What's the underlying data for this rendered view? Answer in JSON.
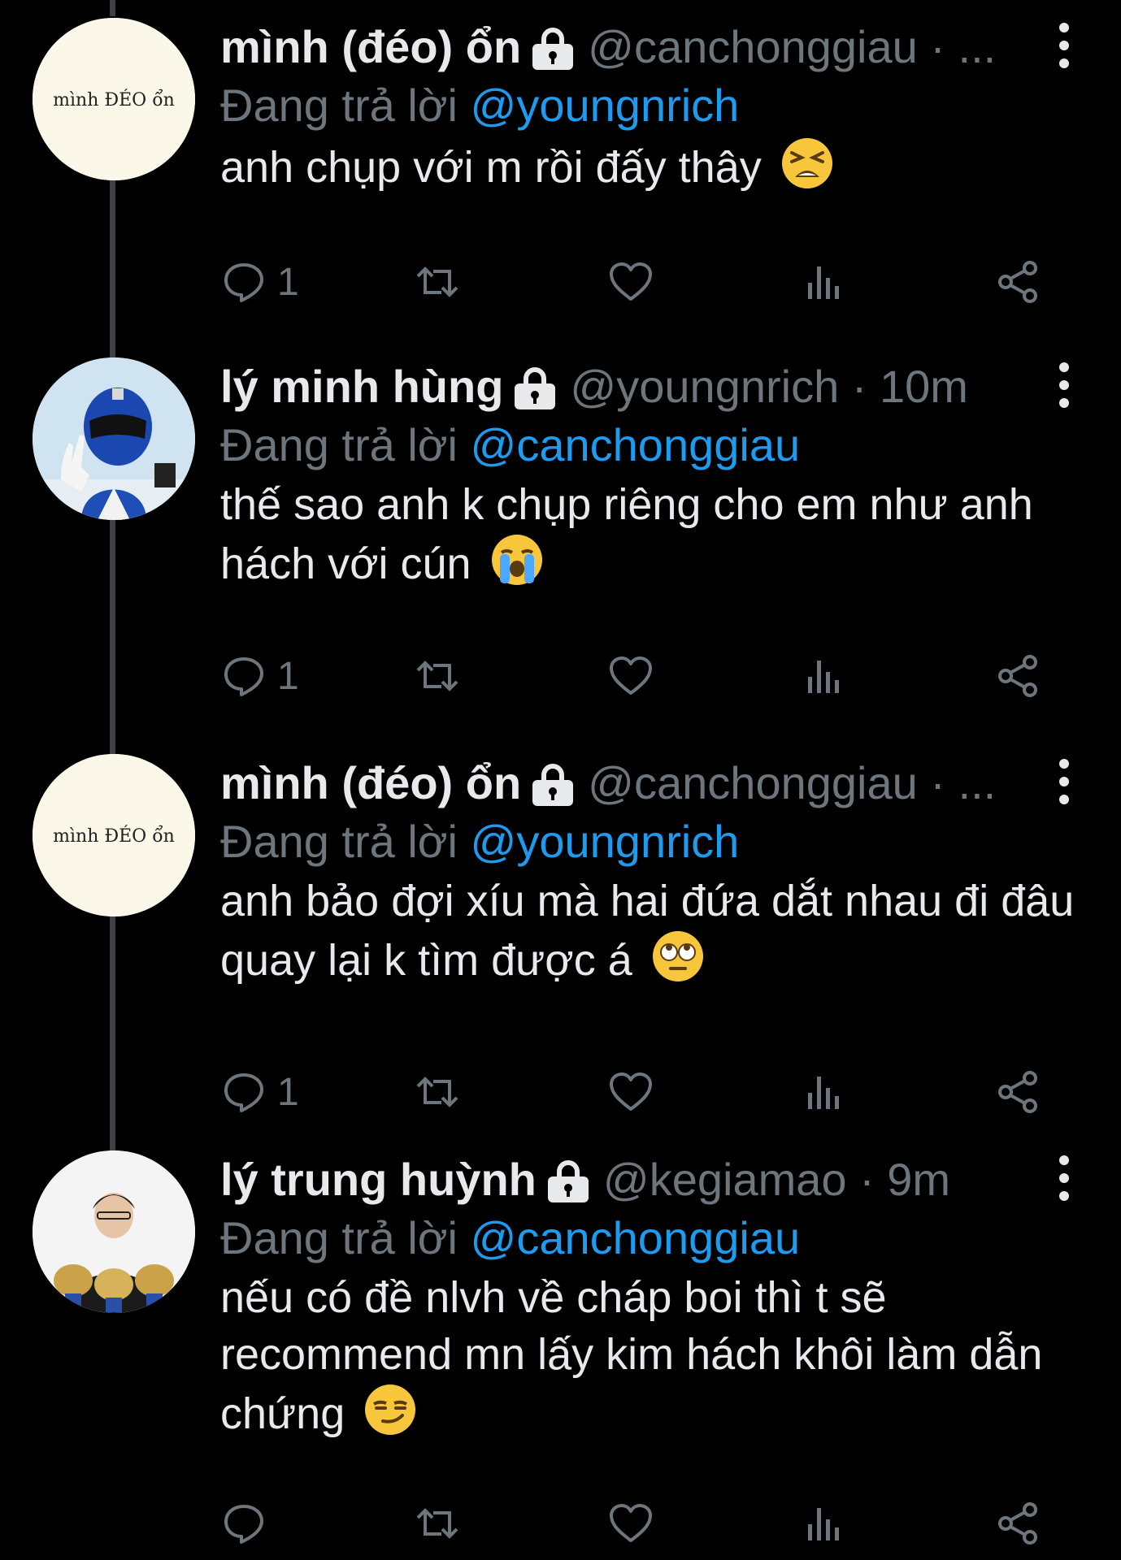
{
  "tweets": [
    {
      "display_name": "mình (đéo) ổn",
      "meta": "@canchonggiau · ...",
      "reply_prefix": "Đang trả lời",
      "reply_to": "@youngnrich",
      "text": "anh chụp với m rồi đấy thây",
      "emoji": "tired-face-emoji",
      "reply_count": "1",
      "avatar": "minh-deo-on-logo",
      "avatar_text": "mình ĐÉO ổn"
    },
    {
      "display_name": "lý minh hùng",
      "meta": "@youngnrich · 10m",
      "reply_prefix": "Đang trả lời",
      "reply_to": "@canchonggiau",
      "text": "thế sao anh k chụp riêng cho em như anh hách với cún",
      "emoji": "loudly-crying-face-emoji",
      "reply_count": "1",
      "avatar": "blue-ranger-photo"
    },
    {
      "display_name": "mình (đéo) ổn",
      "meta": "@canchonggiau · ...",
      "reply_prefix": "Đang trả lời",
      "reply_to": "@youngnrich",
      "text": "anh bảo đợi xíu mà hai đứa dắt nhau đi đâu quay lại k tìm được á",
      "emoji": "face-with-rolling-eyes-emoji",
      "reply_count": "1",
      "avatar": "minh-deo-on-logo",
      "avatar_text": "mình ĐÉO ổn"
    },
    {
      "display_name": "lý trung huỳnh",
      "meta": "@kegiamao · 9m",
      "reply_prefix": "Đang trả lời",
      "reply_to": "@canchonggiau",
      "text": "nếu có đề nlvh về cháp boi thì t sẽ recommend mn lấy kim hách khôi làm dẫn chứng",
      "emoji": "smirking-face-emoji",
      "reply_count": "",
      "avatar": "person-with-trophies-photo"
    }
  ],
  "colors": {
    "background": "#000000",
    "text": "#e7e9ea",
    "secondary": "#6e767d",
    "mention": "#1d9bf0",
    "thread_line": "#3d4145"
  }
}
